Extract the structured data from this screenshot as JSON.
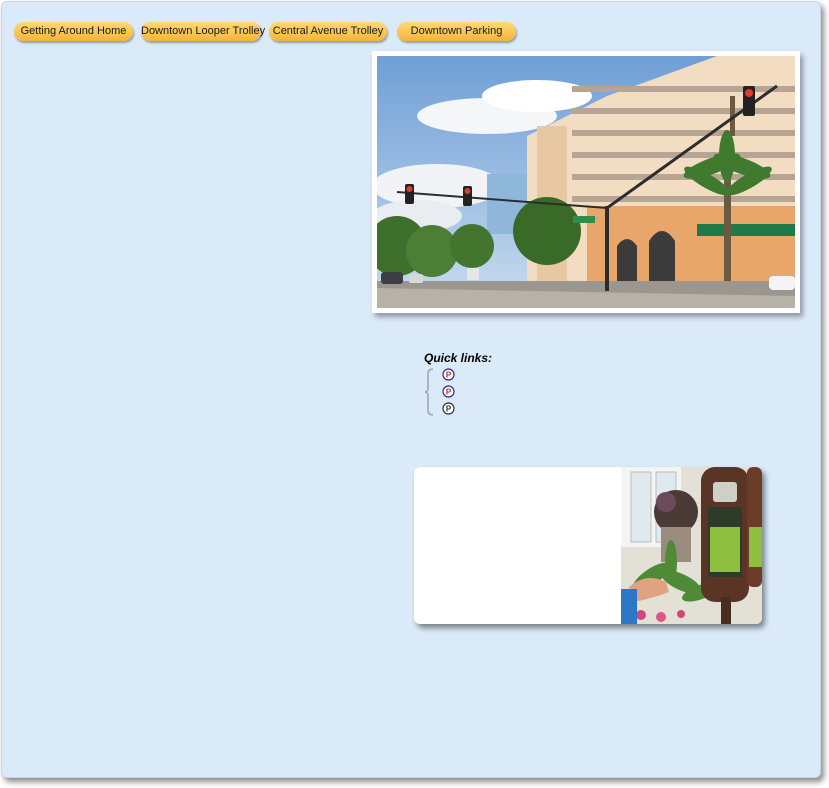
{
  "nav": {
    "tabs": [
      {
        "label": "Getting Around Home"
      },
      {
        "label": "Downtown Looper Trolley"
      },
      {
        "label": "Central Avenue Trolley"
      },
      {
        "label": "Downtown Parking"
      }
    ]
  },
  "quick_links": {
    "title": "Quick links:",
    "items": [
      {
        "icon": "parking-icon",
        "glyph": "P",
        "color": "#c0292b"
      },
      {
        "icon": "parking-icon",
        "glyph": "P",
        "color": "#c0292b"
      },
      {
        "icon": "parking-icon",
        "glyph": "P",
        "color": "#333333"
      }
    ]
  },
  "colors": {
    "background": "#dbeaf9",
    "tab_fill": "#f7c04c"
  }
}
